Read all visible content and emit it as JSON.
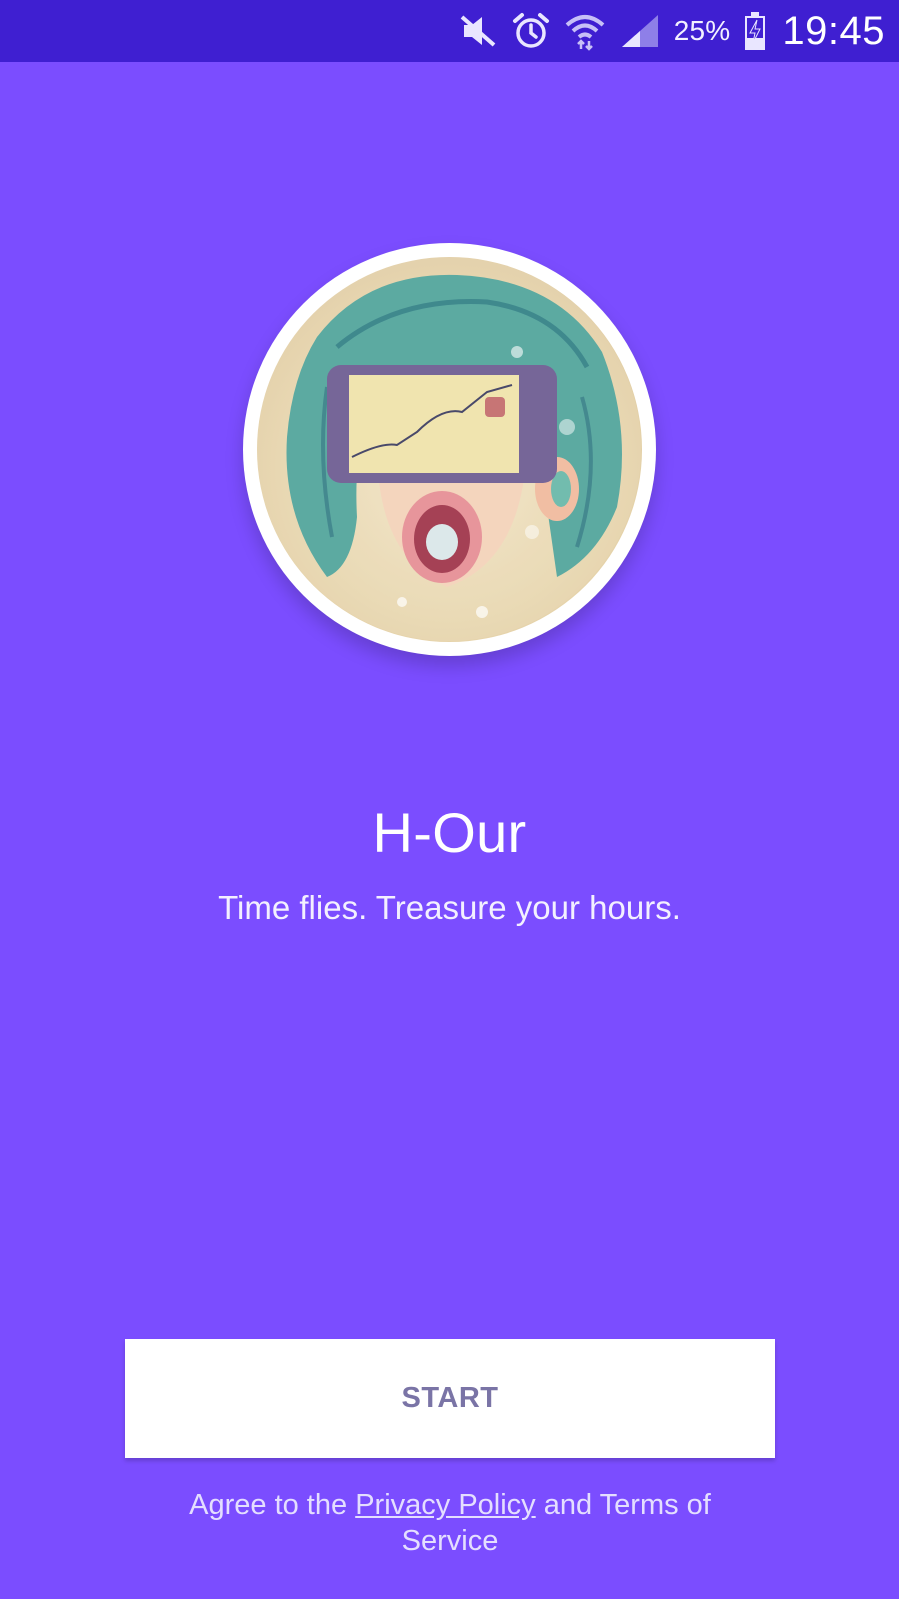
{
  "status_bar": {
    "battery_percent": "25%",
    "time": "19:45",
    "icons": [
      "mute-icon",
      "alarm-icon",
      "wifi-icon",
      "signal-icon",
      "battery-charging-icon"
    ]
  },
  "colors": {
    "background": "#7B4DFF",
    "status_bar": "#3F1FD1",
    "button_background": "#FFFFFF",
    "button_text": "#7A74A6"
  },
  "app": {
    "title": "H-Our",
    "tagline": "Time flies. Treasure your hours."
  },
  "start_button": {
    "label": "START"
  },
  "legal": {
    "prefix": "Agree to the ",
    "privacy_link": "Privacy Policy",
    "middle": " and ",
    "terms_link": "Terms of Service"
  }
}
